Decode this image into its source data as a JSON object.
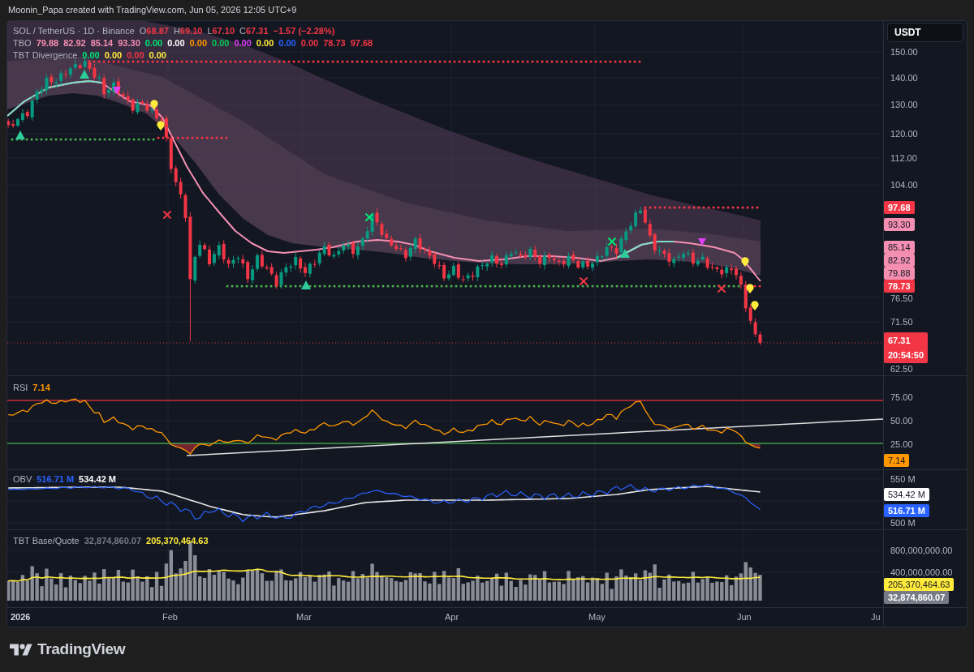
{
  "header": {
    "attribution": "Moonin_Papa created with TradingView.com, Jun 05, 2026 12:05 UTC+9"
  },
  "price_pane": {
    "legend": [
      {
        "title": "SOL / TetherUS · 1D · Binance",
        "values": [
          {
            "prefix": "O",
            "text": "68.87",
            "color": "#f23645"
          },
          {
            "prefix": "H",
            "text": "69.10",
            "color": "#f23645"
          },
          {
            "prefix": "L",
            "text": "67.10",
            "color": "#f23645"
          },
          {
            "prefix": "C",
            "text": "67.31",
            "color": "#f23645"
          },
          {
            "text": "−1.57 (−2.28%)",
            "color": "#f23645"
          }
        ]
      },
      {
        "title": "TBO",
        "values": [
          {
            "text": "79.88",
            "color": "#f48fb1"
          },
          {
            "text": "82.92",
            "color": "#f48fb1"
          },
          {
            "text": "85.14",
            "color": "#f48fb1"
          },
          {
            "text": "93.30",
            "color": "#f48fb1"
          },
          {
            "text": "0.00",
            "color": "#00e676"
          },
          {
            "text": "0.00",
            "color": "#ffffff"
          },
          {
            "text": "0.00",
            "color": "#ff9800"
          },
          {
            "text": "0.00",
            "color": "#00c853"
          },
          {
            "text": "0.00",
            "color": "#e040fb"
          },
          {
            "text": "0.00",
            "color": "#ffeb3b"
          },
          {
            "text": "0.00",
            "color": "#2962ff"
          },
          {
            "text": "0.00",
            "color": "#f23645"
          },
          {
            "text": "78.73",
            "color": "#f23645"
          },
          {
            "text": "97.68",
            "color": "#f23645"
          }
        ]
      },
      {
        "title": "TBT Divergence",
        "values": [
          {
            "text": "0.00",
            "color": "#00e676"
          },
          {
            "text": "0.00",
            "color": "#ffeb3b"
          },
          {
            "text": "0.00",
            "color": "#f23645"
          },
          {
            "text": "0.00",
            "color": "#ffeb3b"
          }
        ]
      }
    ],
    "axis": {
      "button": "USDT",
      "ticks": [
        "150.00",
        "140.00",
        "130.00",
        "120.00",
        "112.00",
        "104.00",
        "76.50",
        "71.50",
        "62.50"
      ],
      "labels": [
        {
          "text": "97.68",
          "color": "#f23645"
        },
        {
          "text": "93.30",
          "color": "#f48fb1"
        },
        {
          "text": "85.14",
          "color": "#f48fb1"
        },
        {
          "text": "82.92",
          "color": "#f48fb1"
        },
        {
          "text": "79.88",
          "color": "#f48fb1"
        },
        {
          "text": "78.73",
          "color": "#f23645"
        },
        {
          "text": "67.31",
          "subtext": "20:54:50",
          "color": "#f23645"
        }
      ]
    }
  },
  "rsi_pane": {
    "legend": [
      {
        "title": "RSI",
        "values": [
          {
            "text": "7.14",
            "color": "#ff9800"
          }
        ]
      }
    ],
    "axis": {
      "ticks": [
        "75.00",
        "50.00",
        "25.00"
      ],
      "labels": [
        {
          "text": "7.14",
          "color": "#ff9800"
        }
      ]
    }
  },
  "obv_pane": {
    "legend": [
      {
        "title": "OBV",
        "values": [
          {
            "text": "516.71 M",
            "color": "#2962ff"
          },
          {
            "text": "534.42 M",
            "color": "#ffffff"
          }
        ]
      }
    ],
    "axis": {
      "ticks": [
        "550 M",
        "500 M"
      ],
      "labels": [
        {
          "text": "534.42 M",
          "color": "#ffffff"
        },
        {
          "text": "516.71 M",
          "color": "#2962ff"
        }
      ]
    }
  },
  "volume_pane": {
    "legend": [
      {
        "title": "TBT Base/Quote",
        "values": [
          {
            "text": "32,874,860.07",
            "color": "#787b86"
          },
          {
            "text": "205,370,464.63",
            "color": "#ffeb3b"
          }
        ]
      }
    ],
    "axis": {
      "ticks": [
        "800,000,000.00",
        "400,000,000.00"
      ],
      "labels": [
        {
          "text": "205,370,464.63",
          "color": "#ffeb3b"
        },
        {
          "text": "32,874,860.07",
          "color": "#787b86"
        }
      ]
    }
  },
  "time_axis": [
    {
      "text": "2026",
      "kind": "year"
    },
    {
      "text": "Feb",
      "kind": "month"
    },
    {
      "text": "Mar",
      "kind": "month"
    },
    {
      "text": "Apr",
      "kind": "month"
    },
    {
      "text": "May",
      "kind": "month"
    },
    {
      "text": "Jun",
      "kind": "month"
    },
    {
      "text": "Ju",
      "kind": "month"
    }
  ],
  "footer": {
    "brand": "TradingView"
  }
}
